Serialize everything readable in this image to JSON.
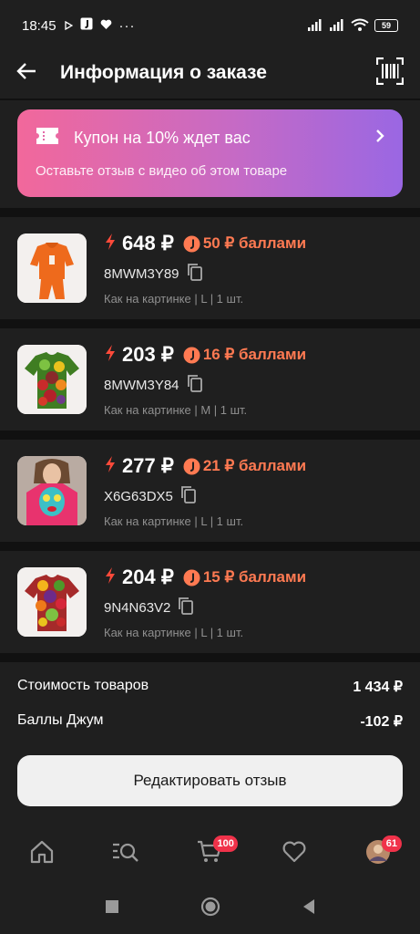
{
  "status": {
    "time": "18:45",
    "battery": "59"
  },
  "header": {
    "title": "Информация о заказе"
  },
  "coupon": {
    "title": "Купон на 10% ждет вас",
    "subtitle": "Оставьте отзыв с видео об этом товаре"
  },
  "items": [
    {
      "price": "648 ₽",
      "points": "50 ₽ баллами",
      "sku": "8MWM3Y89",
      "variant": "Как на картинке | L | 1 шт.",
      "image": "orange-hoodie-set"
    },
    {
      "price": "203 ₽",
      "points": "16 ₽ баллами",
      "sku": "8MWM3Y84",
      "variant": "Как на картинке | M | 1 шт.",
      "image": "fruit-print-tshirt"
    },
    {
      "price": "277 ₽",
      "points": "21 ₽ баллами",
      "sku": "X6G63DX5",
      "variant": "Как на картинке | L | 1 шт.",
      "image": "pop-art-tshirt"
    },
    {
      "price": "204 ₽",
      "points": "15 ₽ баллами",
      "sku": "9N4N63V2",
      "variant": "Как на картинке | L | 1 шт.",
      "image": "fruit-print-tshirt"
    }
  ],
  "summary": {
    "goods_label": "Стоимость товаров",
    "goods_value": "1 434 ₽",
    "points_label": "Баллы Джум",
    "points_value": "-102 ₽"
  },
  "edit_button": "Редактировать отзыв",
  "tabs": {
    "cart_badge": "100",
    "profile_badge": "61"
  },
  "colors": {
    "accent": "#ff7a52",
    "flash": "#ff4a3a",
    "badge": "#f0324a",
    "coupon_start": "#f2689b",
    "coupon_end": "#9a67e3"
  }
}
